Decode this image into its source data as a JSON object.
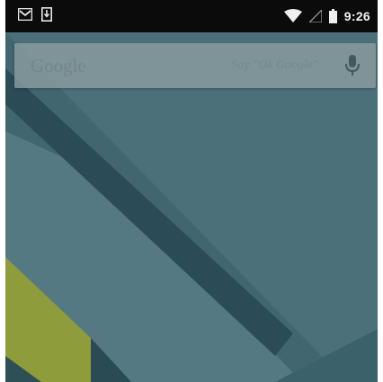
{
  "status_bar": {
    "time": "9:26",
    "icons": [
      "gmail-notification-icon",
      "download-notification-icon",
      "wifi-icon",
      "cellular-signal-icon",
      "battery-icon"
    ]
  },
  "search_widget": {
    "logo_text": "Google",
    "hint_text": "Say \"Ok Google\"",
    "mic_icon": "microphone-icon"
  },
  "colors": {
    "status_bar": "#0b0b0b",
    "wallpaper_base": "#3f6672",
    "accent_yellow": "#8f9c3c",
    "search_bg": "#8a9ca0"
  }
}
